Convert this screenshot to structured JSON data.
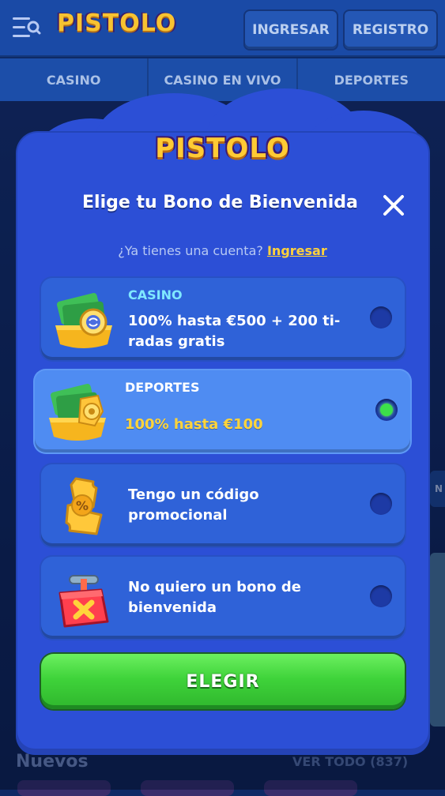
{
  "header": {
    "logo": "PISTOLO",
    "login_label": "INGRESAR",
    "register_label": "REGISTRO"
  },
  "nav": {
    "items": [
      {
        "label": "CASINO"
      },
      {
        "label": "CASINO EN VIVO"
      },
      {
        "label": "DEPORTES"
      }
    ]
  },
  "background": {
    "section_title": "Nuevos",
    "view_all": "VER TODO (837)",
    "side_tab": "N"
  },
  "modal": {
    "logo": "PISTOLO",
    "title": "Elige tu Bono de Bienvenida",
    "account_question": "¿Ya tienes una cuenta?",
    "login_link": "Ingresar",
    "options": [
      {
        "category": "CASINO",
        "text": "100% hasta €500 + 200 ti-radas gratis",
        "selected": false,
        "icon": "casino-bonus-icon"
      },
      {
        "category": "DEPORTES",
        "text": "100% hasta €100",
        "selected": true,
        "icon": "sports-bonus-icon"
      },
      {
        "category": "",
        "text": "Tengo un código promocional",
        "selected": false,
        "icon": "promo-code-icon"
      },
      {
        "category": "",
        "text": "No quiero un bono de bienvenida",
        "selected": false,
        "icon": "no-bonus-icon"
      }
    ],
    "choose_label": "ELEGIR"
  },
  "colors": {
    "modal_bg": "#2c4fd6",
    "option_bg": "#2f62d8",
    "selected_bg": "#4f8cf2",
    "accent_gold": "#ffd23b",
    "button_green": "#3fd33a"
  }
}
